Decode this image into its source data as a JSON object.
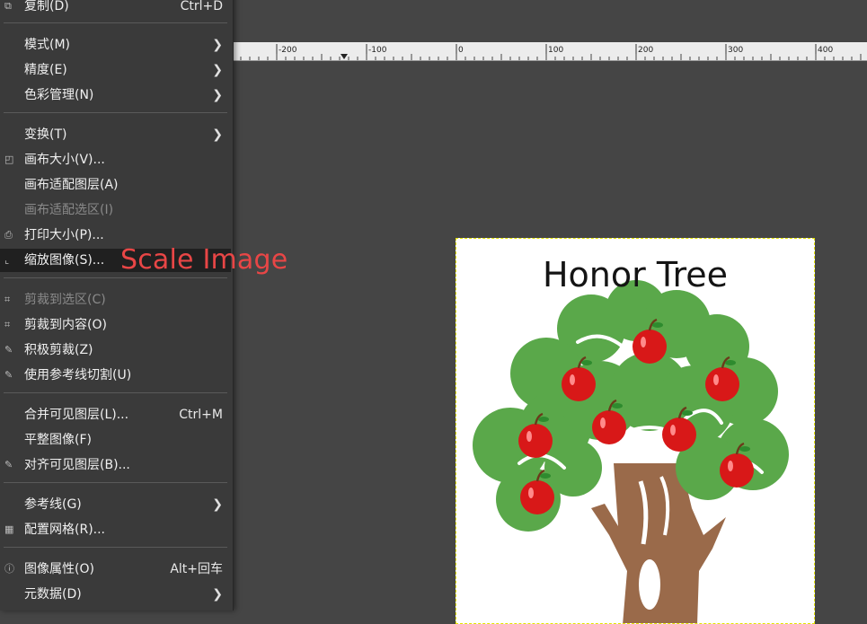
{
  "ruler": {
    "ticks": [
      "-200",
      "-100",
      "0",
      "100",
      "200",
      "300",
      "400"
    ]
  },
  "image": {
    "title": "Honor Tree"
  },
  "annotation": "Scale Image",
  "menu": {
    "duplicate": {
      "label": "复制(D)",
      "accel": "Ctrl+D"
    },
    "mode": {
      "label": "模式(M)"
    },
    "precision": {
      "label": "精度(E)"
    },
    "color_management": {
      "label": "色彩管理(N)"
    },
    "transform": {
      "label": "变换(T)"
    },
    "canvas_size": {
      "label": "画布大小(V)..."
    },
    "fit_canvas_layers": {
      "label": "画布适配图层(A)"
    },
    "fit_canvas_selection": {
      "label": "画布适配选区(I)"
    },
    "print_size": {
      "label": "打印大小(P)..."
    },
    "scale_image": {
      "label": "缩放图像(S)..."
    },
    "crop_to_selection": {
      "label": "剪裁到选区(C)"
    },
    "crop_to_content": {
      "label": "剪裁到内容(O)"
    },
    "zealous_crop": {
      "label": "积极剪裁(Z)"
    },
    "slice_guides": {
      "label": "使用参考线切割(U)"
    },
    "merge_visible": {
      "label": "合并可见图层(L)...",
      "accel": "Ctrl+M"
    },
    "flatten": {
      "label": "平整图像(F)"
    },
    "align_visible": {
      "label": "对齐可见图层(B)..."
    },
    "guides": {
      "label": "参考线(G)"
    },
    "configure_grid": {
      "label": "配置网格(R)..."
    },
    "image_properties": {
      "label": "图像属性(O)",
      "accel": "Alt+回车"
    },
    "metadata": {
      "label": "元数据(D)"
    }
  },
  "colors": {
    "menu_bg": "#3a3a3a",
    "canvas_bg": "#454545",
    "annotation": "#e84646",
    "leaf": "#5aa84a",
    "trunk": "#9a6a4a",
    "apple": "#d81818"
  }
}
